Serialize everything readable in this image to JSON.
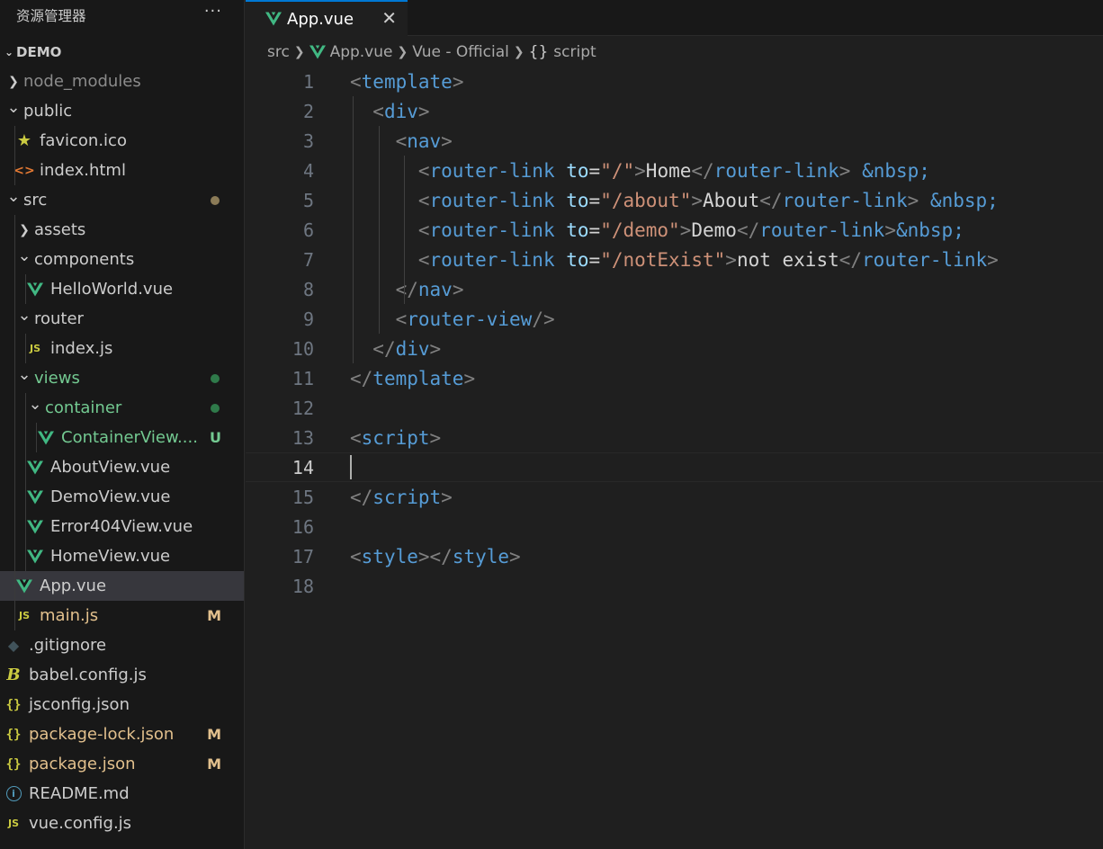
{
  "sidebar": {
    "title": "资源管理器",
    "more": "···",
    "section": "DEMO",
    "items": [
      {
        "label": "node_modules",
        "kind": "folder",
        "open": false,
        "depth": 0,
        "color": "#8b8b8b"
      },
      {
        "label": "public",
        "kind": "folder",
        "open": true,
        "depth": 0,
        "color": "#cccccc"
      },
      {
        "label": "favicon.ico",
        "kind": "star",
        "depth": 1,
        "color": "#cccccc"
      },
      {
        "label": "index.html",
        "kind": "html",
        "depth": 1,
        "color": "#cccccc"
      },
      {
        "label": "src",
        "kind": "folder",
        "open": true,
        "depth": 0,
        "color": "#cccccc",
        "dot": "#8b7b57"
      },
      {
        "label": "assets",
        "kind": "folder",
        "open": false,
        "depth": 1,
        "color": "#cccccc"
      },
      {
        "label": "components",
        "kind": "folder",
        "open": true,
        "depth": 1,
        "color": "#cccccc"
      },
      {
        "label": "HelloWorld.vue",
        "kind": "vue",
        "depth": 2,
        "color": "#cccccc"
      },
      {
        "label": "router",
        "kind": "folder",
        "open": true,
        "depth": 1,
        "color": "#cccccc"
      },
      {
        "label": "index.js",
        "kind": "js",
        "depth": 2,
        "color": "#cccccc"
      },
      {
        "label": "views",
        "kind": "folder",
        "open": true,
        "depth": 1,
        "color": "#73c991",
        "dot": "#2f7a4a"
      },
      {
        "label": "container",
        "kind": "folder",
        "open": true,
        "depth": 2,
        "color": "#73c991",
        "dot": "#2f7a4a"
      },
      {
        "label": "ContainerView....",
        "kind": "vue",
        "depth": 3,
        "color": "#73c991",
        "status": "U",
        "statusColor": "#73c991"
      },
      {
        "label": "AboutView.vue",
        "kind": "vue",
        "depth": 2,
        "color": "#cccccc"
      },
      {
        "label": "DemoView.vue",
        "kind": "vue",
        "depth": 2,
        "color": "#cccccc"
      },
      {
        "label": "Error404View.vue",
        "kind": "vue",
        "depth": 2,
        "color": "#cccccc"
      },
      {
        "label": "HomeView.vue",
        "kind": "vue",
        "depth": 2,
        "color": "#cccccc"
      },
      {
        "label": "App.vue",
        "kind": "vue",
        "depth": 1,
        "color": "#cccccc",
        "selected": true
      },
      {
        "label": "main.js",
        "kind": "js",
        "depth": 1,
        "color": "#e2c08d",
        "status": "M",
        "statusColor": "#e2c08d"
      },
      {
        "label": ".gitignore",
        "kind": "git",
        "depth": 0,
        "color": "#cccccc"
      },
      {
        "label": "babel.config.js",
        "kind": "babel",
        "depth": 0,
        "color": "#cccccc"
      },
      {
        "label": "jsconfig.json",
        "kind": "json",
        "depth": 0,
        "color": "#cccccc"
      },
      {
        "label": "package-lock.json",
        "kind": "json",
        "depth": 0,
        "color": "#e2c08d",
        "status": "M",
        "statusColor": "#e2c08d"
      },
      {
        "label": "package.json",
        "kind": "json",
        "depth": 0,
        "color": "#e2c08d",
        "status": "M",
        "statusColor": "#e2c08d"
      },
      {
        "label": "README.md",
        "kind": "info",
        "depth": 0,
        "color": "#cccccc"
      },
      {
        "label": "vue.config.js",
        "kind": "js",
        "depth": 0,
        "color": "#cccccc"
      }
    ]
  },
  "tab": {
    "label": "App.vue",
    "close": "✕"
  },
  "breadcrumb": {
    "src": "src",
    "file": "App.vue",
    "lang": "Vue - Official",
    "braces": "{}",
    "symbol": "script"
  },
  "editor": {
    "activeLine": 14,
    "lines": [
      {
        "n": "1",
        "tokens": [
          [
            "brk",
            "<"
          ],
          [
            "tag",
            "template"
          ],
          [
            "brk",
            ">"
          ]
        ]
      },
      {
        "n": "2",
        "tokens": [
          [
            "txt",
            "  "
          ],
          [
            "brk",
            "<"
          ],
          [
            "tag",
            "div"
          ],
          [
            "brk",
            ">"
          ]
        ]
      },
      {
        "n": "3",
        "tokens": [
          [
            "txt",
            "    "
          ],
          [
            "brk",
            "<"
          ],
          [
            "tag",
            "nav"
          ],
          [
            "brk",
            ">"
          ]
        ]
      },
      {
        "n": "4",
        "tokens": [
          [
            "txt",
            "      "
          ],
          [
            "brk",
            "<"
          ],
          [
            "tag",
            "router-link"
          ],
          [
            "txt",
            " "
          ],
          [
            "attr",
            "to"
          ],
          [
            "eq",
            "="
          ],
          [
            "str",
            "\"/\""
          ],
          [
            "brk",
            ">"
          ],
          [
            "txt",
            "Home"
          ],
          [
            "brk",
            "</"
          ],
          [
            "tag",
            "router-link"
          ],
          [
            "brk",
            ">"
          ],
          [
            "txt",
            " "
          ],
          [
            "ent",
            "&nbsp;"
          ]
        ]
      },
      {
        "n": "5",
        "tokens": [
          [
            "txt",
            "      "
          ],
          [
            "brk",
            "<"
          ],
          [
            "tag",
            "router-link"
          ],
          [
            "txt",
            " "
          ],
          [
            "attr",
            "to"
          ],
          [
            "eq",
            "="
          ],
          [
            "str",
            "\"/about\""
          ],
          [
            "brk",
            ">"
          ],
          [
            "txt",
            "About"
          ],
          [
            "brk",
            "</"
          ],
          [
            "tag",
            "router-link"
          ],
          [
            "brk",
            ">"
          ],
          [
            "txt",
            " "
          ],
          [
            "ent",
            "&nbsp;"
          ]
        ]
      },
      {
        "n": "6",
        "tokens": [
          [
            "txt",
            "      "
          ],
          [
            "brk",
            "<"
          ],
          [
            "tag",
            "router-link"
          ],
          [
            "txt",
            " "
          ],
          [
            "attr",
            "to"
          ],
          [
            "eq",
            "="
          ],
          [
            "str",
            "\"/demo\""
          ],
          [
            "brk",
            ">"
          ],
          [
            "txt",
            "Demo"
          ],
          [
            "brk",
            "</"
          ],
          [
            "tag",
            "router-link"
          ],
          [
            "brk",
            ">"
          ],
          [
            "ent",
            "&nbsp;"
          ]
        ]
      },
      {
        "n": "7",
        "tokens": [
          [
            "txt",
            "      "
          ],
          [
            "brk",
            "<"
          ],
          [
            "tag",
            "router-link"
          ],
          [
            "txt",
            " "
          ],
          [
            "attr",
            "to"
          ],
          [
            "eq",
            "="
          ],
          [
            "str",
            "\"/notExist\""
          ],
          [
            "brk",
            ">"
          ],
          [
            "txt",
            "not exist"
          ],
          [
            "brk",
            "</"
          ],
          [
            "tag",
            "router-link"
          ],
          [
            "brk",
            ">"
          ]
        ]
      },
      {
        "n": "8",
        "tokens": [
          [
            "txt",
            "    "
          ],
          [
            "brk",
            "</"
          ],
          [
            "tag",
            "nav"
          ],
          [
            "brk",
            ">"
          ]
        ]
      },
      {
        "n": "9",
        "tokens": [
          [
            "txt",
            "    "
          ],
          [
            "brk",
            "<"
          ],
          [
            "tag",
            "router-view"
          ],
          [
            "brk",
            "/>"
          ]
        ]
      },
      {
        "n": "10",
        "tokens": [
          [
            "txt",
            "  "
          ],
          [
            "brk",
            "</"
          ],
          [
            "tag",
            "div"
          ],
          [
            "brk",
            ">"
          ]
        ]
      },
      {
        "n": "11",
        "tokens": [
          [
            "brk",
            "</"
          ],
          [
            "tag",
            "template"
          ],
          [
            "brk",
            ">"
          ]
        ]
      },
      {
        "n": "12",
        "tokens": []
      },
      {
        "n": "13",
        "tokens": [
          [
            "brk",
            "<"
          ],
          [
            "tag",
            "script"
          ],
          [
            "brk",
            ">"
          ]
        ]
      },
      {
        "n": "14",
        "tokens": []
      },
      {
        "n": "15",
        "tokens": [
          [
            "brk",
            "</"
          ],
          [
            "tag",
            "script"
          ],
          [
            "brk",
            ">"
          ]
        ]
      },
      {
        "n": "16",
        "tokens": []
      },
      {
        "n": "17",
        "tokens": [
          [
            "brk",
            "<"
          ],
          [
            "tag",
            "style"
          ],
          [
            "brk",
            "></"
          ],
          [
            "tag",
            "style"
          ],
          [
            "brk",
            ">"
          ]
        ]
      },
      {
        "n": "18",
        "tokens": []
      }
    ]
  }
}
